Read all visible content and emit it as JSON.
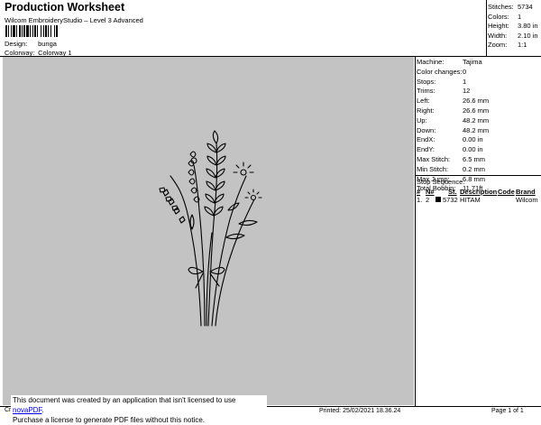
{
  "header": {
    "title": "Production Worksheet",
    "subtitle": "Wilcom EmbroideryStudio – Level 3 Advanced",
    "design_label": "Design:",
    "design_value": "bunga",
    "colorway_label": "Colorway:",
    "colorway_value": "Colorway 1"
  },
  "stats": [
    {
      "k": "Stitches:",
      "v": "5734"
    },
    {
      "k": "Colors:",
      "v": "1"
    },
    {
      "k": "Height:",
      "v": "3.80 in"
    },
    {
      "k": "Width:",
      "v": "2.10 in"
    },
    {
      "k": "Zoom:",
      "v": "1:1"
    }
  ],
  "info": [
    {
      "k": "Machine:",
      "v": "Tajima"
    },
    {
      "k": "Color changes:",
      "v": "0"
    },
    {
      "k": "Stops:",
      "v": "1"
    },
    {
      "k": "Trims:",
      "v": "12"
    },
    {
      "k": "Left:",
      "v": "26.6 mm"
    },
    {
      "k": "Right:",
      "v": "26.6 mm"
    },
    {
      "k": "Up:",
      "v": "48.2 mm"
    },
    {
      "k": "Down:",
      "v": "48.2 mm"
    },
    {
      "k": "EndX:",
      "v": "0.00 in"
    },
    {
      "k": "EndY:",
      "v": "0.00 in"
    },
    {
      "k": "Max Stitch:",
      "v": "6.5 mm"
    },
    {
      "k": "Min Stitch:",
      "v": "0.2 mm"
    },
    {
      "k": "Max Jump:",
      "v": "6.8 mm"
    },
    {
      "k": "Total Bobbin:",
      "v": "11.71ft"
    }
  ],
  "stop_sequence": {
    "title": "Stop Sequence:",
    "headers": [
      "#",
      "N#",
      "St.",
      "Description",
      "Code",
      "Brand"
    ],
    "rows": [
      {
        "num": "1.",
        "n": "2",
        "st": "5732",
        "desc": "HITAM",
        "code": "",
        "brand": "Wilcom",
        "color": "#000000"
      }
    ]
  },
  "footer": {
    "left": "Cr",
    "printed": "Printed: 25/02/2021 18.36.24",
    "page": "Page 1 of 1",
    "notice_line1": "This document was created by an application that isn't licensed to use ",
    "notice_link": "novaPDF",
    "notice_line1_end": ".",
    "notice_line2": "Purchase a license to generate PDF files without this notice."
  },
  "colors": {
    "preview_bg": "#c3c3c3",
    "thread": "#000000"
  }
}
